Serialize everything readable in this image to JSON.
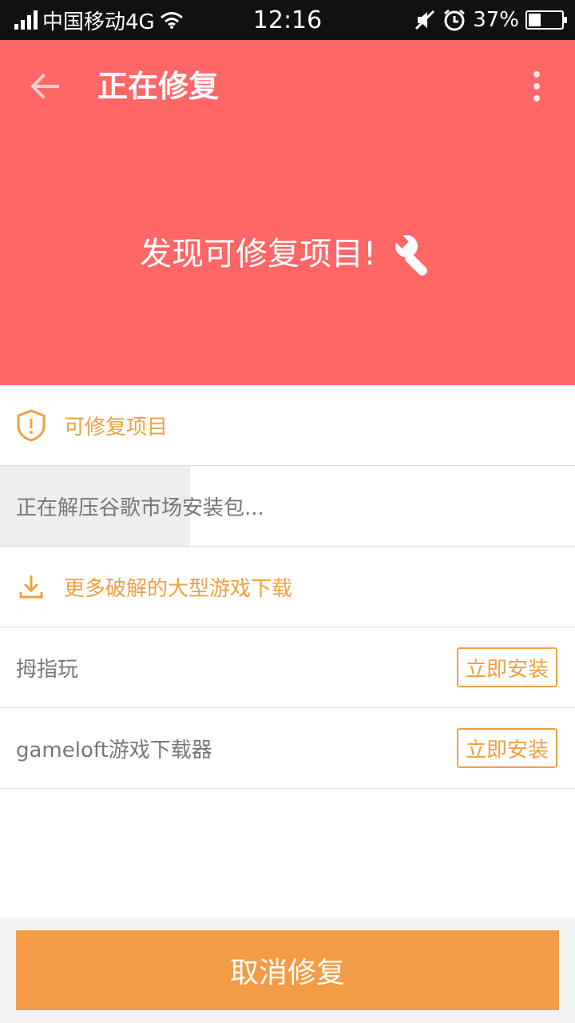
{
  "status_bar": {
    "carrier": "中国移动4G",
    "time": "12:16",
    "battery_percent": "37%",
    "battery_level": 0.37
  },
  "header": {
    "title": "正在修复",
    "hero_text": "发现可修复项目!",
    "background_color": "#ff6666"
  },
  "list": {
    "section_repair": "可修复项目",
    "progress_item": {
      "label": "正在解压谷歌市场安装包...",
      "progress": 0.33
    },
    "section_download": "更多破解的大型游戏下载",
    "apps": [
      {
        "name": "拇指玩",
        "action": "立即安装"
      },
      {
        "name": "gameloft游戏下载器",
        "action": "立即安装"
      }
    ]
  },
  "footer": {
    "cancel_label": "取消修复",
    "accent_color": "#f29c46"
  },
  "icons": {
    "back": "arrow-left-icon",
    "more": "more-vertical-icon",
    "wrench": "wrench-icon",
    "shield": "shield-alert-icon",
    "download": "download-icon"
  }
}
